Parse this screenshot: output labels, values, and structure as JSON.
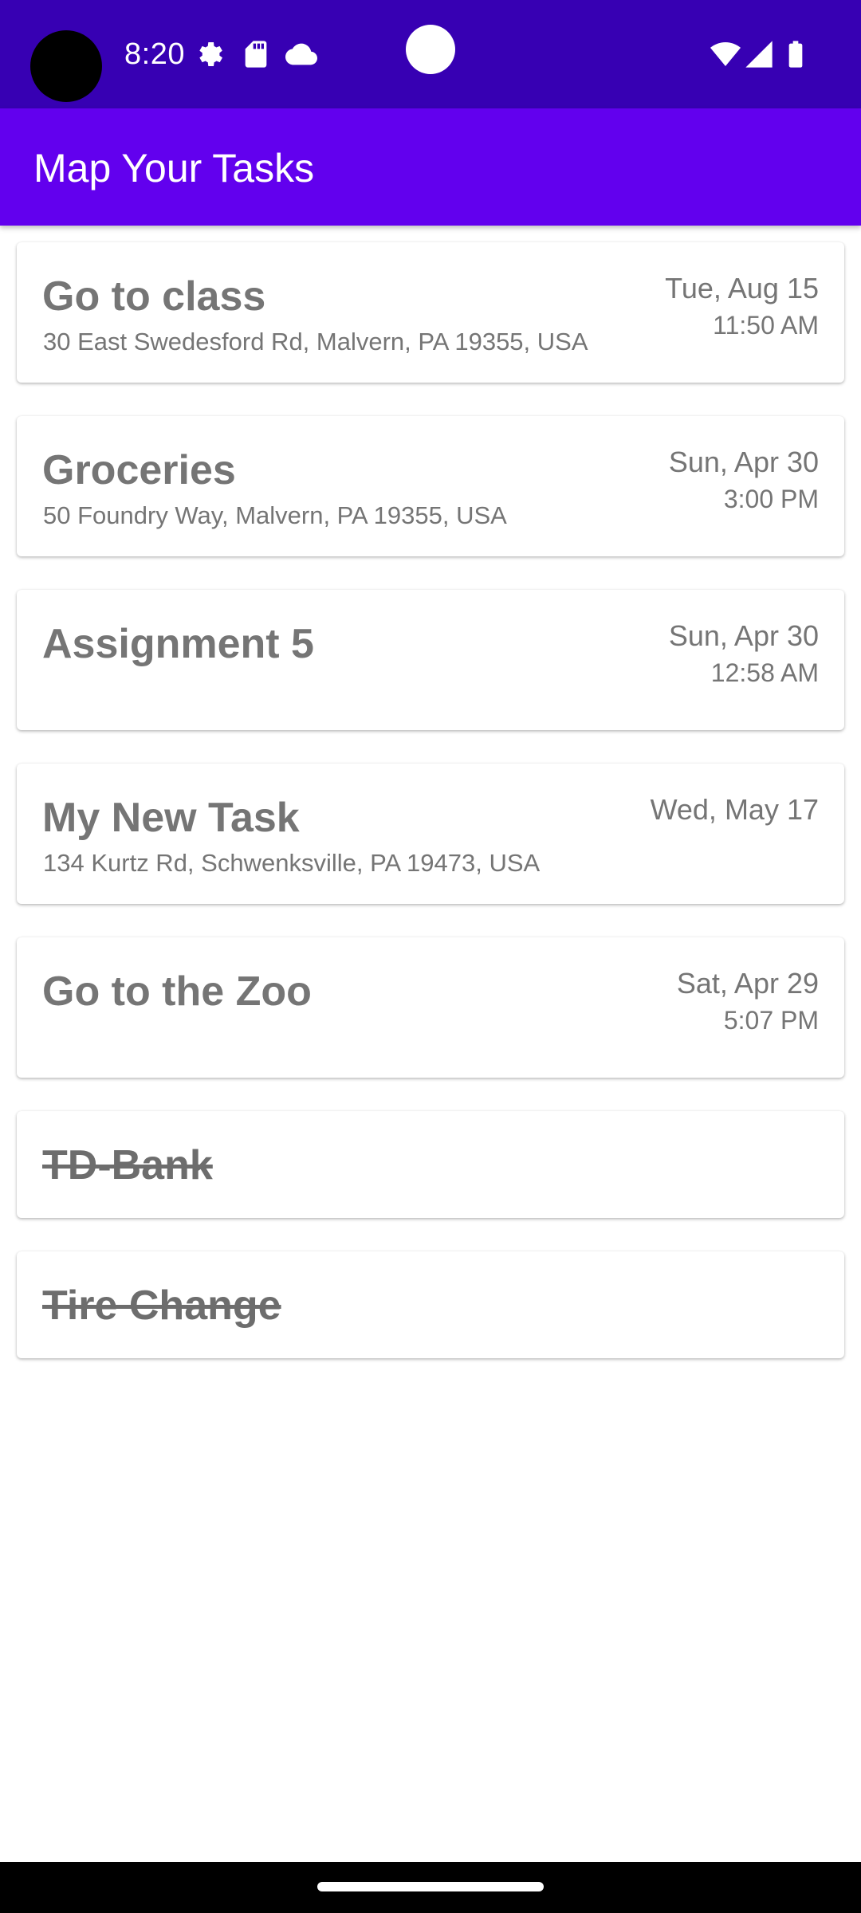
{
  "status_bar": {
    "time": "8:20",
    "icons": [
      "settings-gear-icon",
      "sd-card-icon",
      "cloud-icon",
      "wifi-icon",
      "signal-icon",
      "battery-icon"
    ]
  },
  "app_bar": {
    "title": "Map Your Tasks"
  },
  "tasks": [
    {
      "title": "Go to class",
      "address": "30 East Swedesford Rd, Malvern, PA 19355, USA",
      "date": "Tue, Aug 15",
      "time": "11:50 AM",
      "completed": false
    },
    {
      "title": "Groceries",
      "address": "50 Foundry Way, Malvern, PA 19355, USA",
      "date": "Sun, Apr 30",
      "time": "3:00 PM",
      "completed": false
    },
    {
      "title": "Assignment 5",
      "address": "",
      "date": "Sun, Apr 30",
      "time": "12:58 AM",
      "completed": false
    },
    {
      "title": "My New Task",
      "address": "134 Kurtz Rd, Schwenksville, PA 19473, USA",
      "date": "Wed, May 17",
      "time": "",
      "completed": false
    },
    {
      "title": "Go to the Zoo",
      "address": "",
      "date": "Sat, Apr 29",
      "time": "5:07 PM",
      "completed": false
    },
    {
      "title": "TD-Bank",
      "address": "",
      "date": "",
      "time": "",
      "completed": true
    },
    {
      "title": "Tire Change",
      "address": "",
      "date": "",
      "time": "",
      "completed": true
    }
  ],
  "colors": {
    "status_bar": "#3700b3",
    "app_bar": "#6200ee",
    "text_secondary": "#757575"
  }
}
